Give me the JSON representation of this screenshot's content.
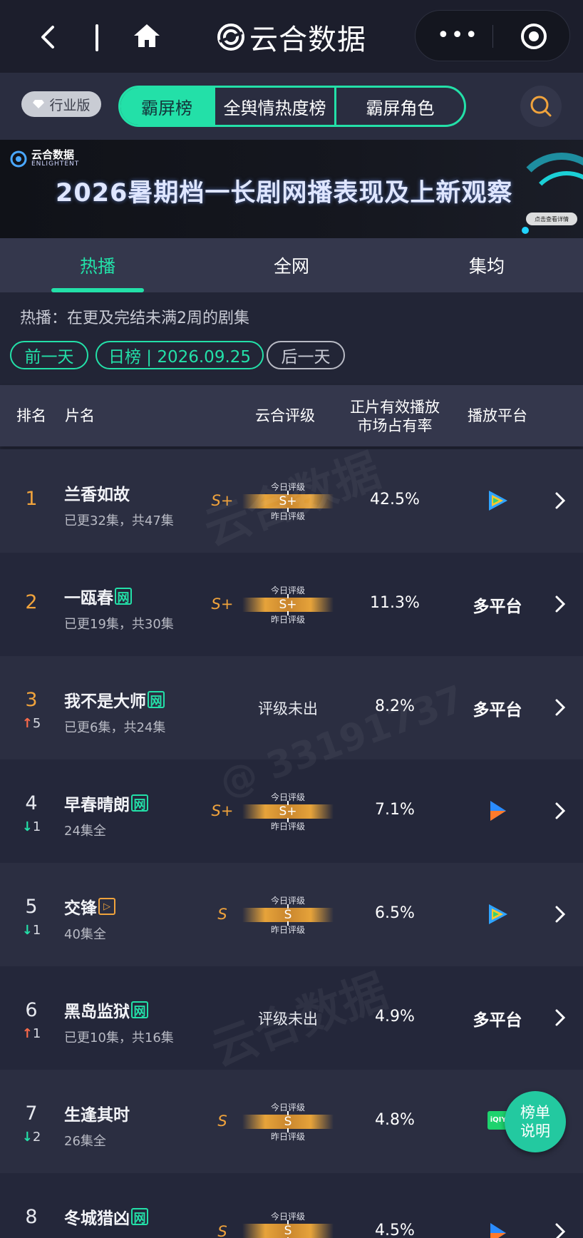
{
  "topbar": {
    "brand": "云合数据"
  },
  "nav": {
    "badge": "行业版",
    "segments": [
      "霸屏榜",
      "全舆情热度榜",
      "霸屏角色"
    ]
  },
  "banner": {
    "logo_cn": "云合数据",
    "logo_en": "ENLIGHTENT",
    "title": "2026暑期档一长剧网播表现及上新观察",
    "cta": "点击查看详情"
  },
  "tabs": [
    "热播",
    "全网",
    "集均"
  ],
  "description": "热播：在更及完结未满2周的剧集",
  "date_controls": {
    "prev": "前一天",
    "current": "日榜 | 2026.09.25",
    "next": "后一天"
  },
  "table": {
    "headers": {
      "rank": "排名",
      "title": "片名",
      "grade": "云合评级",
      "share_line1": "正片有效播放",
      "share_line2": "市场占有率",
      "platform": "播放平台"
    },
    "gauge_labels": {
      "today": "今日评级",
      "yesterday": "昨日评级"
    },
    "rows": [
      {
        "rank": "1",
        "change": "",
        "title": "兰香如故",
        "tag": "",
        "subtitle": "已更32集，共47集",
        "grade_yesterday": "S+",
        "grade_today": "S+",
        "share": "42.5%",
        "platform": "",
        "platform_icon": "tencent-video"
      },
      {
        "rank": "2",
        "change": "",
        "title": "一瓯春",
        "tag": "网",
        "subtitle": "已更19集，共30集",
        "grade_yesterday": "S+",
        "grade_today": "S+",
        "share": "11.3%",
        "platform": "多平台",
        "platform_icon": ""
      },
      {
        "rank": "3",
        "change": "5",
        "change_dir": "up",
        "title": "我不是大师",
        "tag": "网",
        "subtitle": "已更6集，共24集",
        "grade_text": "评级未出",
        "share": "8.2%",
        "platform": "多平台",
        "platform_icon": ""
      },
      {
        "rank": "4",
        "change": "1",
        "change_dir": "down",
        "title": "早春晴朗",
        "tag": "网",
        "subtitle": "24集全",
        "grade_yesterday": "S+",
        "grade_today": "S+",
        "share": "7.1%",
        "platform": "",
        "platform_icon": "youku"
      },
      {
        "rank": "5",
        "change": "1",
        "change_dir": "down",
        "title": "交锋",
        "tag": "youku",
        "subtitle": "40集全",
        "grade_yesterday": "S",
        "grade_today": "S",
        "share": "6.5%",
        "platform": "",
        "platform_icon": "tencent-video"
      },
      {
        "rank": "6",
        "change": "1",
        "change_dir": "up",
        "title": "黑岛监狱",
        "tag": "网",
        "subtitle": "已更10集，共16集",
        "grade_text": "评级未出",
        "share": "4.9%",
        "platform": "多平台",
        "platform_icon": ""
      },
      {
        "rank": "7",
        "change": "2",
        "change_dir": "down",
        "title": "生逢其时",
        "tag": "",
        "subtitle": "26集全",
        "grade_yesterday": "S",
        "grade_today": "S",
        "share": "4.8%",
        "platform": "",
        "platform_icon": "iqiyi"
      },
      {
        "rank": "8",
        "change": "",
        "title": "冬城猎凶",
        "tag": "网",
        "subtitle": "",
        "grade_yesterday": "S",
        "grade_today": "S",
        "share": "4.5%",
        "platform": "",
        "platform_icon": "youku"
      }
    ]
  },
  "fab": {
    "line1": "榜单",
    "line2": "说明"
  },
  "watermarks": [
    "云合数据",
    "ENLIGHTENT",
    "@ 33191737"
  ],
  "colors": {
    "accent": "#23e0a8",
    "gold": "#f0a33c",
    "up": "#ff6b4a",
    "down": "#23e0a8"
  }
}
